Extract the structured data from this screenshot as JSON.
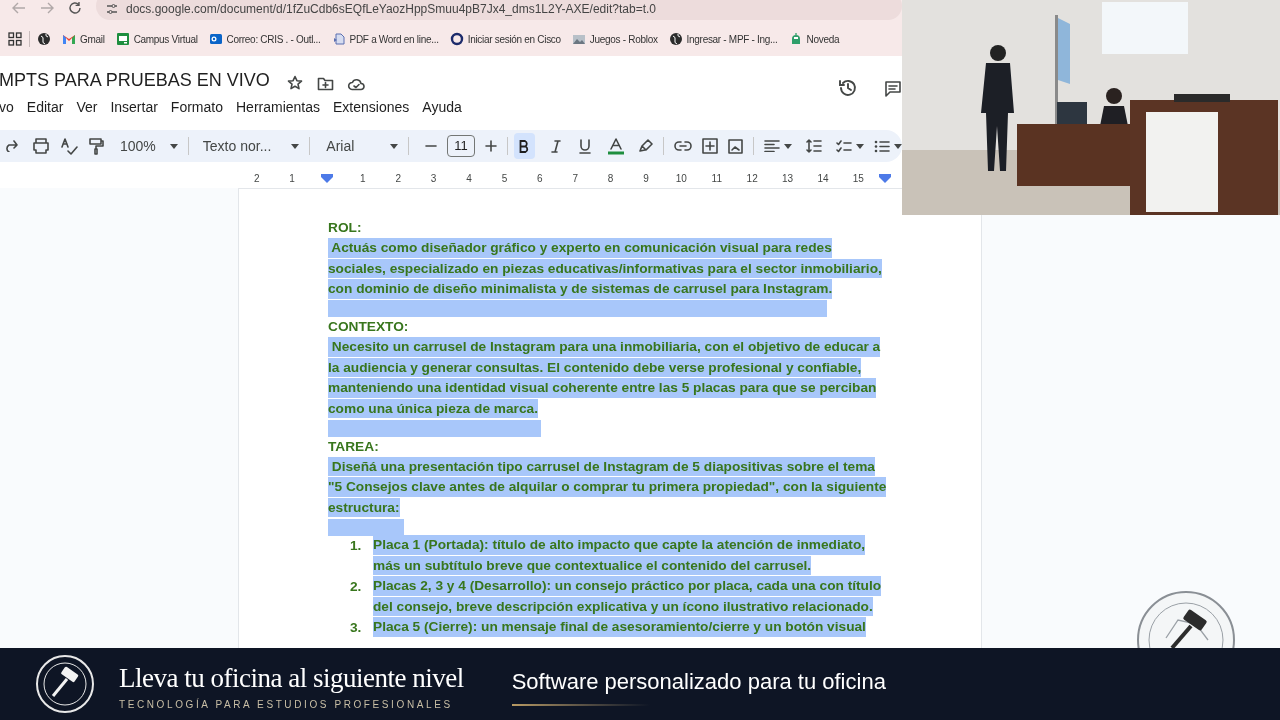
{
  "browser": {
    "url": "docs.google.com/document/d/1fZuCdb6sEQfLeYaozHppSmuu4pB7Jx4_dms1L2Y-AXE/edit?tab=t.0",
    "bookmarks": [
      {
        "label": "Gmail"
      },
      {
        "label": "Campus Virtual"
      },
      {
        "label": "Correo: CRIS . - Outl..."
      },
      {
        "label": "PDF a Word en line..."
      },
      {
        "label": "Iniciar sesión en Cisco"
      },
      {
        "label": "Juegos - Roblox"
      },
      {
        "label": "Ingresar - MPF - Ing..."
      },
      {
        "label": "Noveda"
      }
    ]
  },
  "document": {
    "title": "MPTS PARA PRUEBAS EN VIVO",
    "menu": [
      "vo",
      "Editar",
      "Ver",
      "Insertar",
      "Formato",
      "Herramientas",
      "Extensiones",
      "Ayuda"
    ],
    "toolbar": {
      "zoom": "100%",
      "style": "Texto nor...",
      "font": "Arial",
      "font_size": "11",
      "bold": true
    },
    "ruler": [
      "2",
      "1",
      "1",
      "2",
      "3",
      "4",
      "5",
      "6",
      "7",
      "8",
      "9",
      "10",
      "11",
      "12",
      "13",
      "14",
      "15"
    ],
    "blocks": [
      {
        "kind": "heading",
        "text": "ROL:",
        "selected": false
      },
      {
        "kind": "paragraph",
        "selected": true,
        "lines": [
          " Actuás como diseñador gráfico y experto en comunicación visual para redes",
          "sociales, especializado en piezas educativas/informativas para el sector inmobiliario,",
          "con dominio de diseño minimalista y de sistemas de carrusel para Instagram."
        ]
      },
      {
        "kind": "heading",
        "text": "CONTEXTO:",
        "selected": false
      },
      {
        "kind": "paragraph",
        "selected": true,
        "lines": [
          " Necesito un carrusel de Instagram para una inmobiliaria, con el objetivo de educar a",
          "la audiencia y generar consultas. El contenido debe verse profesional y confiable,",
          "manteniendo una identidad visual coherente entre las 5 placas para que se perciban",
          "como una única pieza de marca."
        ]
      },
      {
        "kind": "heading",
        "text": "TAREA:",
        "selected": false
      },
      {
        "kind": "paragraph",
        "selected": true,
        "lines": [
          " Diseñá una presentación tipo carrusel de Instagram de 5 diapositivas sobre el tema",
          "\"5 Consejos clave antes de alquilar o comprar tu primera propiedad\", con la siguiente",
          "estructura:"
        ]
      },
      {
        "kind": "list",
        "selected": true,
        "items": [
          {
            "marker": "1.",
            "lines": [
              "Placa 1 (Portada): título de alto impacto que capte la atención de inmediato,",
              "más un subtítulo breve que contextualice el contenido del carrusel."
            ]
          },
          {
            "marker": "2.",
            "lines": [
              "Placas 2, 3 y 4 (Desarrollo): un consejo práctico por placa, cada una con título",
              "del consejo, breve descripción explicativa y un ícono ilustrativo relacionado."
            ]
          },
          {
            "marker": "3.",
            "lines": [
              "Placa 5 (Cierre): un mensaje final de asesoramiento/cierre y un botón visual"
            ]
          }
        ]
      }
    ]
  },
  "banner": {
    "headline": "Lleva tu oficina al siguiente nivel",
    "tagline": "TECNOLOGÍA PARA ESTUDIOS PROFESIONALES",
    "slogan": "Software personalizado para tu oficina"
  }
}
